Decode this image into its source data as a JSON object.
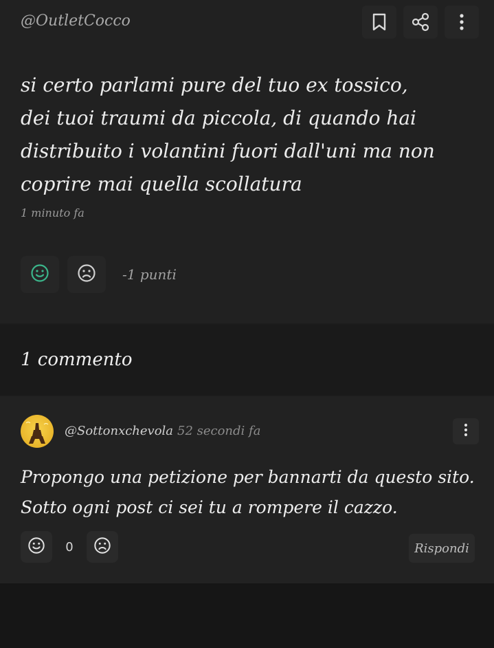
{
  "post": {
    "author": "@OutletCocco",
    "body": "si certo parlami pure del tuo ex tossico,\ndei tuoi traumi da piccola, di quando hai\ndistribuito i volantini fuori dall'uni ma non\ncoprire mai quella scollatura",
    "time": "1 minuto fa",
    "points": "-1 punti",
    "icons": {
      "bookmark": "bookmark-icon",
      "share": "share-icon",
      "menu": "more-vertical-icon",
      "upvote": "smile-icon",
      "downvote": "frown-icon"
    },
    "colors": {
      "upvote": "#3bb58a"
    }
  },
  "comments": {
    "count_label": "1 commento",
    "items": [
      {
        "author": "@Sottonxchevola",
        "time": "52 secondi fa",
        "body": "Propongo una petizione per bannarti da questo sito.\nSotto ogni post ci sei tu a rompere il cazzo.",
        "score": "0",
        "reply_label": "Rispondi"
      }
    ]
  }
}
